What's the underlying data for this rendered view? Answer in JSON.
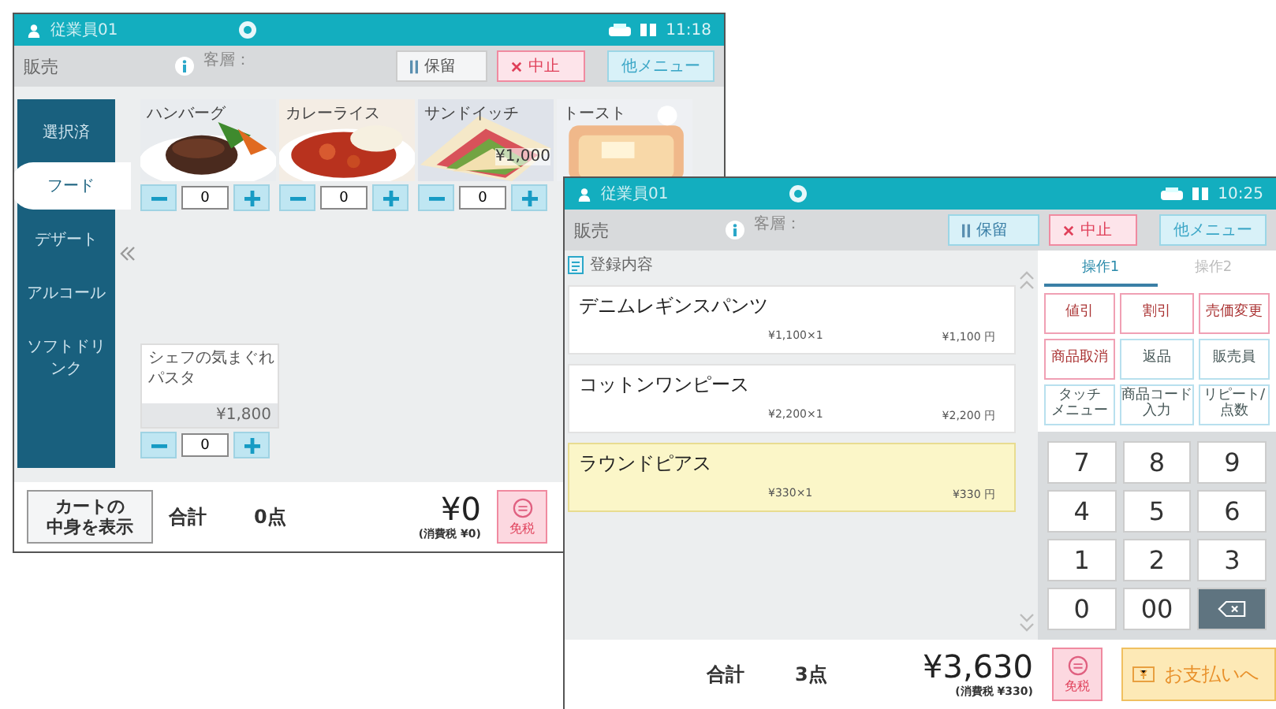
{
  "windows": [
    {
      "kind": "catalog",
      "header": {
        "user": "従業員01",
        "time": "11:18"
      },
      "toolbar": {
        "title": "販売",
        "customer_label": "客層：",
        "buttons": [
          {
            "kind": "hold",
            "label": "保留"
          },
          {
            "kind": "cancel",
            "label": "中止"
          },
          {
            "kind": "menu",
            "label": "他メニュー"
          }
        ]
      },
      "categories": [
        {
          "label": "選択済",
          "selected": false
        },
        {
          "label": "フード",
          "selected": true
        },
        {
          "label": "デザート",
          "selected": false
        },
        {
          "label": "アルコール",
          "selected": false
        },
        {
          "label": "ソフトドリンク",
          "selected": false
        }
      ],
      "products": [
        {
          "kind": "picture",
          "name": "ハンバーグ",
          "quantity": "0"
        },
        {
          "kind": "picture",
          "name": "カレーライス",
          "quantity": "0"
        },
        {
          "kind": "picture",
          "name": "サンドイッチ",
          "price": "¥1,000",
          "quantity": "0"
        },
        {
          "kind": "picture",
          "name": "トースト"
        },
        {
          "kind": "text",
          "name": [
            "シェフの気まぐれ",
            "パスタ"
          ],
          "price": "¥1,800",
          "quantity": "0"
        }
      ],
      "footer": {
        "cart_button": [
          "カートの",
          "中身を表示"
        ],
        "total_label": "合計",
        "count": "0点",
        "amount": "¥0",
        "tax": "(消費税 ¥0)",
        "tax_free": "免税"
      }
    },
    {
      "kind": "register",
      "header": {
        "user": "従業員01",
        "time": "10:25"
      },
      "toolbar": {
        "title": "販売",
        "customer_label": "客層：",
        "buttons": [
          {
            "kind": "hold",
            "label": "保留"
          },
          {
            "kind": "cancel",
            "label": "中止"
          },
          {
            "kind": "menu",
            "label": "他メニュー"
          }
        ]
      },
      "list_title": "登録内容",
      "items": [
        {
          "name": "デニムレギンスパンツ",
          "unit": "¥1,100×1",
          "subtotal": "¥1,100 円",
          "selected": false
        },
        {
          "name": "コットンワンピース",
          "unit": "¥2,200×1",
          "subtotal": "¥2,200 円",
          "selected": false
        },
        {
          "name": "ラウンドピアス",
          "unit": "¥330×1",
          "subtotal": "¥330 円",
          "selected": true
        }
      ],
      "tabs": [
        {
          "label": "操作1",
          "selected": true
        },
        {
          "label": "操作2",
          "selected": false
        }
      ],
      "functions": [
        {
          "label": "値引",
          "kind": "alert"
        },
        {
          "label": "割引",
          "kind": "alert"
        },
        {
          "label": "売価変更",
          "kind": "alert"
        },
        {
          "label": "商品取消",
          "kind": "alert"
        },
        {
          "label": "返品",
          "kind": "normal"
        },
        {
          "label": "販売員",
          "kind": "normal"
        },
        {
          "label": [
            "タッチ",
            "メニュー"
          ],
          "kind": "normal"
        },
        {
          "label": [
            "商品コード",
            "入力"
          ],
          "kind": "normal"
        },
        {
          "label": [
            "リピート/",
            "点数"
          ],
          "kind": "normal"
        }
      ],
      "keys": [
        {
          "kind": "digit",
          "label": "7"
        },
        {
          "kind": "digit",
          "label": "8"
        },
        {
          "kind": "digit",
          "label": "9"
        },
        {
          "kind": "digit",
          "label": "4"
        },
        {
          "kind": "digit",
          "label": "5"
        },
        {
          "kind": "digit",
          "label": "6"
        },
        {
          "kind": "digit",
          "label": "1"
        },
        {
          "kind": "digit",
          "label": "2"
        },
        {
          "kind": "digit",
          "label": "3"
        },
        {
          "kind": "digit",
          "label": "0"
        },
        {
          "kind": "digit",
          "label": "00"
        },
        {
          "kind": "backspace"
        }
      ],
      "footer": {
        "total_label": "合計",
        "count": "3点",
        "amount": "¥3,630",
        "tax": "(消費税 ¥330)",
        "tax_free": "免税",
        "pay_button": "お支払いへ"
      }
    }
  ]
}
